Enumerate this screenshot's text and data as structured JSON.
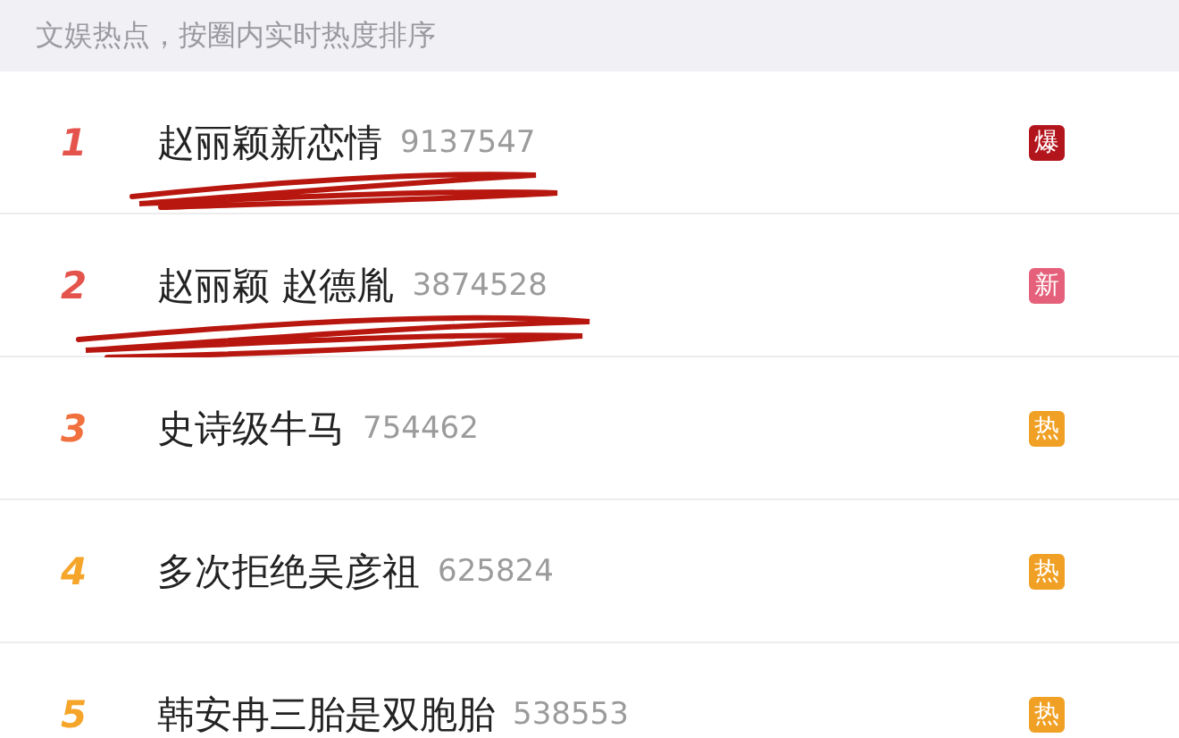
{
  "header": {
    "text": "文娱热点，按圈内实时热度排序"
  },
  "items": [
    {
      "rank": {
        "text": "1",
        "color": "#e4544c"
      },
      "title": "赵丽颖新恋情",
      "count": "9137547",
      "badge": {
        "text": "爆",
        "color": "#b3151c"
      },
      "annotated": true
    },
    {
      "rank": {
        "text": "2",
        "color": "#e4544c"
      },
      "title": "赵丽颖 赵德胤",
      "count": "3874528",
      "badge": {
        "text": "新",
        "color": "#e5607a"
      },
      "annotated": true
    },
    {
      "rank": {
        "text": "3",
        "color": "#f0703e"
      },
      "title": "史诗级牛马",
      "count": "754462",
      "badge": {
        "text": "热",
        "color": "#f0a024"
      },
      "annotated": false
    },
    {
      "rank": {
        "text": "4",
        "color": "#f5a52a"
      },
      "title": "多次拒绝吴彦祖",
      "count": "625824",
      "badge": {
        "text": "热",
        "color": "#f0a024"
      },
      "annotated": false
    },
    {
      "rank": {
        "text": "5",
        "color": "#f5a52a"
      },
      "title": "韩安冉三胎是双胞胎",
      "count": "538553",
      "badge": {
        "text": "热",
        "color": "#f0a024"
      },
      "annotated": false
    }
  ]
}
